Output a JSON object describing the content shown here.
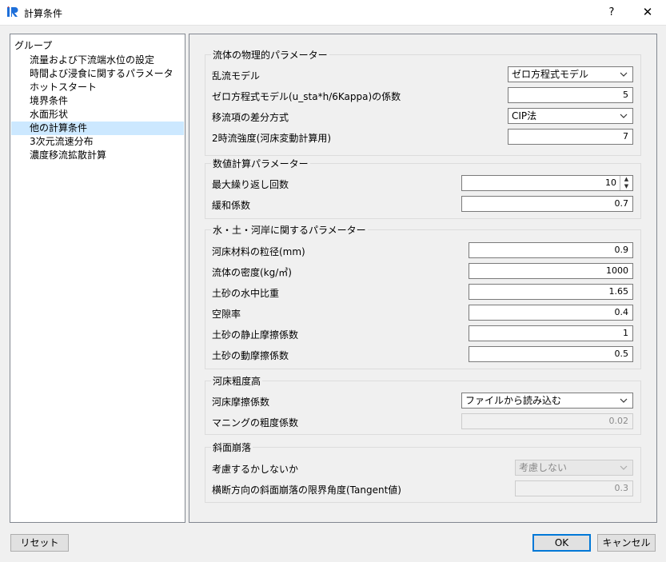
{
  "window": {
    "title": "計算条件",
    "help": "?",
    "close": "✕"
  },
  "group": {
    "header": "グループ",
    "items": [
      "流量および下流端水位の設定",
      "時間よび浸食に関するパラメータ",
      "ホットスタート",
      "境界条件",
      "水面形状",
      "他の計算条件",
      "3次元流速分布",
      "濃度移流拡散計算"
    ],
    "selected_index": 5
  },
  "sections": {
    "fluid": {
      "title": "流体の物理的パラメーター",
      "turbulence_label": "乱流モデル",
      "turbulence_value": "ゼロ方程式モデル",
      "zero_eq_label": "ゼロ方程式モデル(u_sta*h/6Kappa)の係数",
      "zero_eq_value": "5",
      "advection_label": "移流項の差分方式",
      "advection_value": "CIP法",
      "secondary_label": "2時流強度(河床変動計算用)",
      "secondary_value": "7"
    },
    "numerical": {
      "title": "数値計算パラメーター",
      "max_iter_label": "最大繰り返し回数",
      "max_iter_value": "10",
      "relax_label": "緩和係数",
      "relax_value": "0.7"
    },
    "water_soil": {
      "title": "水・土・河岸に関するパラメーター",
      "grain_label": "河床材料の粒径(mm)",
      "grain_value": "0.9",
      "density_label": "流体の密度(kg/㎥)",
      "density_value": "1000",
      "specific_label": "土砂の水中比重",
      "specific_value": "1.65",
      "porosity_label": "空隙率",
      "porosity_value": "0.4",
      "static_label": "土砂の静止摩擦係数",
      "static_value": "1",
      "dynamic_label": "土砂の動摩擦係数",
      "dynamic_value": "0.5"
    },
    "roughness": {
      "title": "河床粗度高",
      "friction_label": "河床摩擦係数",
      "friction_value": "ファイルから読み込む",
      "manning_label": "マニングの粗度係数",
      "manning_value": "0.02"
    },
    "slope": {
      "title": "斜面崩落",
      "consider_label": "考慮するかしないか",
      "consider_value": "考慮しない",
      "angle_label": "横断方向の斜面崩落の限界角度(Tangent値)",
      "angle_value": "0.3"
    }
  },
  "buttons": {
    "reset": "リセット",
    "ok": "OK",
    "cancel": "キャンセル"
  },
  "colors": {
    "selection": "#cce8ff",
    "accent": "#0078d7",
    "app_icon": "#1e6fd9"
  }
}
